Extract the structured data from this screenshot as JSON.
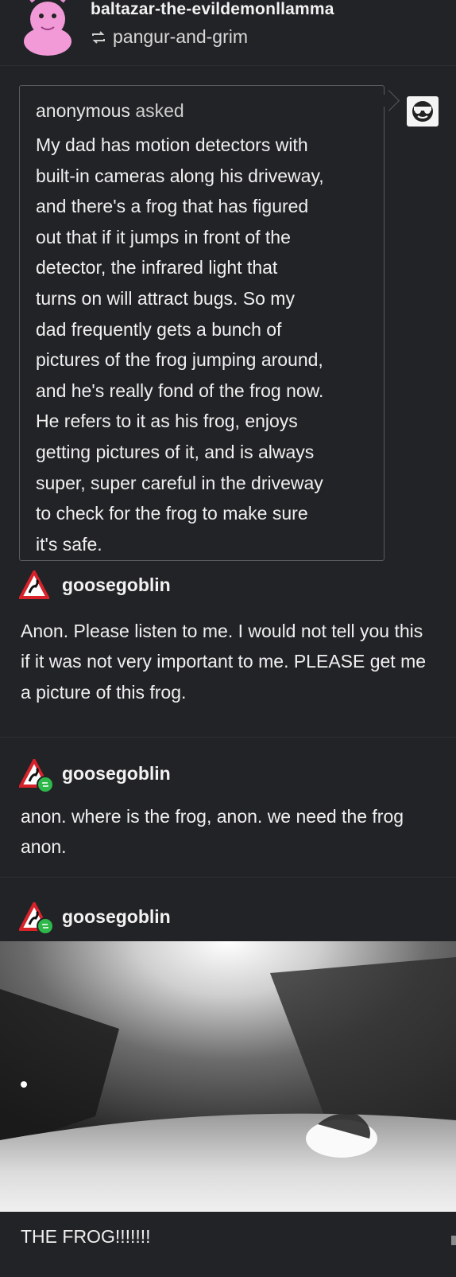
{
  "header": {
    "blog_name": "baltazar-the-evildemonllamma",
    "reblogged_from": "pangur-and-grim"
  },
  "ask": {
    "asker": "anonymous",
    "verb": "asked",
    "text": "My dad has motion detectors with\nbuilt-in cameras along his driveway,\nand there's a frog that has figured\nout that if it jumps in front of the\ndetector, the infrared light that\nturns on will attract bugs. So my\ndad frequently gets a bunch of\npictures of the frog jumping around,\nand he's really fond of the frog now.\nHe refers to it as his frog, enjoys\ngetting pictures of it, and is always\nsuper, super careful in the driveway\nto check for the frog to make sure\nit's safe."
  },
  "replies": [
    {
      "user": "goosegoblin",
      "text": "Anon. Please listen to me. I would not tell you this if it was not very important to me. PLEASE get me a picture of this frog."
    },
    {
      "user": "goosegoblin",
      "text": "anon. where is the frog, anon. we need the frog anon."
    },
    {
      "user": "goosegoblin",
      "caption": "THE FROG!!!!!!!"
    }
  ],
  "icons": {
    "reblog": "reblog-icon",
    "anon_avatar": "sunglasses-face-icon",
    "goose_avatar": "goose-warning-sign-icon"
  },
  "colors": {
    "background": "#222326",
    "reblog_green": "#2fb84a",
    "warning_red": "#d8222a"
  }
}
